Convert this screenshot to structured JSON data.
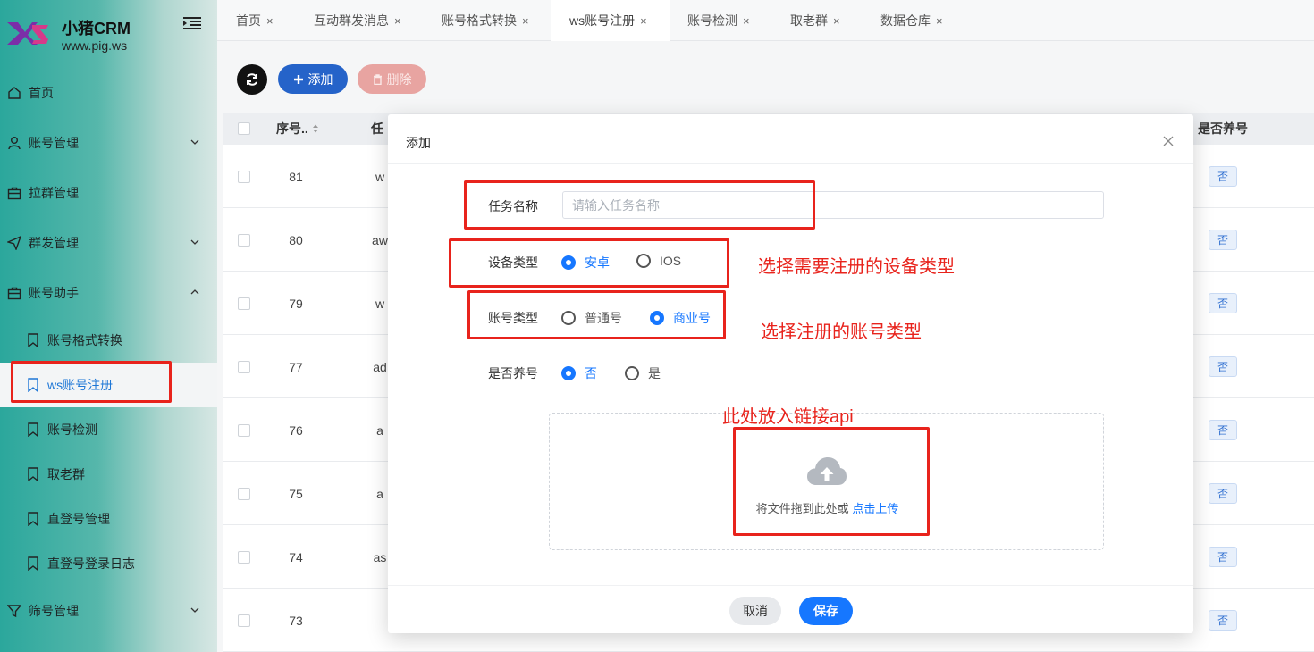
{
  "brand": {
    "title": "小猪CRM",
    "subtitle": "www.pig.ws",
    "logo_text": "XZ"
  },
  "colors": {
    "primary": "#1677ff",
    "annotation": "#e8231c",
    "sidebar_start": "#2ba79c",
    "danger_disabled": "#e8a4a1"
  },
  "sidebar": {
    "items": [
      {
        "label": "首页",
        "icon": "home-icon"
      },
      {
        "label": "账号管理",
        "icon": "user-icon"
      },
      {
        "label": "拉群管理",
        "icon": "briefcase-icon"
      },
      {
        "label": "群发管理",
        "icon": "send-icon"
      },
      {
        "label": "账号助手",
        "icon": "briefcase-icon"
      },
      {
        "label": "筛号管理",
        "icon": "filter-icon"
      }
    ],
    "sub_items": [
      {
        "label": "账号格式转换"
      },
      {
        "label": "ws账号注册"
      },
      {
        "label": "账号检测"
      },
      {
        "label": "取老群"
      },
      {
        "label": "直登号管理"
      },
      {
        "label": "直登号登录日志"
      }
    ]
  },
  "tabs": [
    {
      "label": "首页",
      "close": "×"
    },
    {
      "label": "互动群发消息",
      "close": "×"
    },
    {
      "label": "账号格式转换",
      "close": "×"
    },
    {
      "label": "ws账号注册",
      "close": "×"
    },
    {
      "label": "账号检测",
      "close": "×"
    },
    {
      "label": "取老群",
      "close": "×"
    },
    {
      "label": "数据仓库",
      "close": "×"
    }
  ],
  "toolbar": {
    "add_label": "添加",
    "delete_label": "删除"
  },
  "table": {
    "headers": {
      "seq": "序号..",
      "task": "任",
      "raise": "是否养号"
    },
    "rows": [
      {
        "seq": "81",
        "task": "w",
        "raise": "否"
      },
      {
        "seq": "80",
        "task": "aw",
        "raise": "否"
      },
      {
        "seq": "79",
        "task": "w",
        "raise": "否"
      },
      {
        "seq": "77",
        "task": "ad",
        "raise": "否"
      },
      {
        "seq": "76",
        "task": "a",
        "raise": "否"
      },
      {
        "seq": "75",
        "task": "a",
        "raise": "否"
      },
      {
        "seq": "74",
        "task": "as",
        "raise": "否"
      },
      {
        "seq": "73",
        "task": "",
        "raise": "否"
      }
    ]
  },
  "modal": {
    "title": "添加",
    "task_name_label": "任务名称",
    "task_name_placeholder": "请输入任务名称",
    "task_name_value": "",
    "device_label": "设备类型",
    "device_options": [
      "安卓",
      "IOS"
    ],
    "device_selected": "安卓",
    "account_label": "账号类型",
    "account_options": [
      "普通号",
      "商业号"
    ],
    "account_selected": "商业号",
    "raise_label": "是否养号",
    "raise_options": [
      "否",
      "是"
    ],
    "raise_selected": "否",
    "upload_text": "将文件拖到此处或",
    "upload_link": "点击上传",
    "cancel_label": "取消",
    "save_label": "保存"
  },
  "annotations": {
    "device": "选择需要注册的设备类型",
    "account": "选择注册的账号类型",
    "upload": "此处放入链接api"
  }
}
